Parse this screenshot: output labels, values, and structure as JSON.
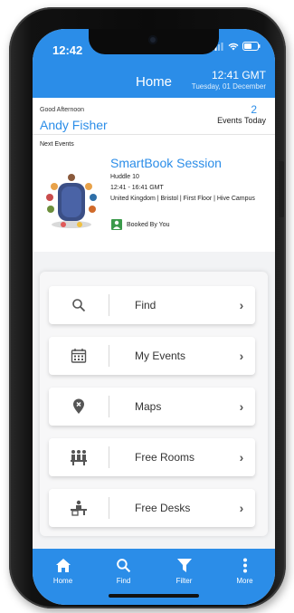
{
  "status_bar": {
    "time": "12:42"
  },
  "header": {
    "title": "Home",
    "clock_time": "12:41 GMT",
    "clock_date": "Tuesday, 01 December"
  },
  "greeting": {
    "text": "Good Afternoon",
    "user_name": "Andy Fisher",
    "events_count": "2",
    "events_label": "Events Today"
  },
  "next_events": {
    "label": "Next Events",
    "event": {
      "title": "SmartBook Session",
      "room": "Huddle 10",
      "time": "12:41 - 16:41 GMT",
      "location": "United Kingdom | Bristol | First Floor | Hive Campus",
      "booked_by": "Booked By You"
    },
    "carousel_active_index": 1,
    "carousel_count": 2
  },
  "menu": {
    "items": [
      {
        "label": "Find",
        "icon": "search-icon"
      },
      {
        "label": "My Events",
        "icon": "calendar-icon"
      },
      {
        "label": "Maps",
        "icon": "map-pin-icon"
      },
      {
        "label": "Free Rooms",
        "icon": "meeting-room-icon"
      },
      {
        "label": "Free Desks",
        "icon": "desk-icon"
      }
    ]
  },
  "bottom_nav": {
    "items": [
      {
        "label": "Home",
        "icon": "home-icon"
      },
      {
        "label": "Find",
        "icon": "search-icon"
      },
      {
        "label": "Filter",
        "icon": "filter-icon"
      },
      {
        "label": "More",
        "icon": "more-vertical-icon"
      }
    ]
  },
  "colors": {
    "accent": "#2b8de8",
    "background": "#f2f3f5"
  }
}
